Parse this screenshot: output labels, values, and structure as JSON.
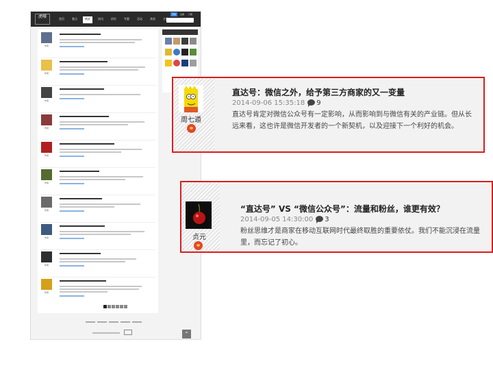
{
  "mini_page": {
    "logo": "虎嗅",
    "nav": [
      "首页",
      "看点",
      "热文",
      "快讯",
      "研究",
      "专题",
      "活动",
      "其他",
      "大数"
    ],
    "login": [
      "登录",
      "注册",
      "订阅"
    ],
    "items": [
      {
        "label": "作者"
      },
      {
        "label": "作者"
      },
      {
        "label": "作者"
      },
      {
        "label": "作者"
      },
      {
        "label": "作者"
      },
      {
        "label": "作者"
      },
      {
        "label": "作者"
      },
      {
        "label": "作者"
      },
      {
        "label": "作者"
      },
      {
        "label": "作者"
      }
    ],
    "top_button": "⌃"
  },
  "callouts": [
    {
      "author": "周七遁",
      "title": "直达号：微信之外，给予第三方商家的又一变量",
      "date": "2014-09-06 15:35:18",
      "comment_count": "9",
      "excerpt": "直达号肯定对微信公众号有一定影响，从而影响到与微信有关的产业链。但从长远来看，这也许是微信开发者的一个新契机，以及迎接下一个利好的机会。"
    },
    {
      "author": "贞元",
      "title": "“直达号” VS “微信公众号”：流量和粉丝，谁更有效？",
      "date": "2014-09-05 14:30:00",
      "comment_count": "3",
      "excerpt": "粉丝思维才是商家在移动互联网时代最终取胜的重要依仗。我们不能沉浸在流量里，而忘记了初心。"
    }
  ],
  "colors": {
    "callout_border": "#d91d1d",
    "header_dark": "#2a2a2a",
    "weibo_red": "#e4462b"
  }
}
